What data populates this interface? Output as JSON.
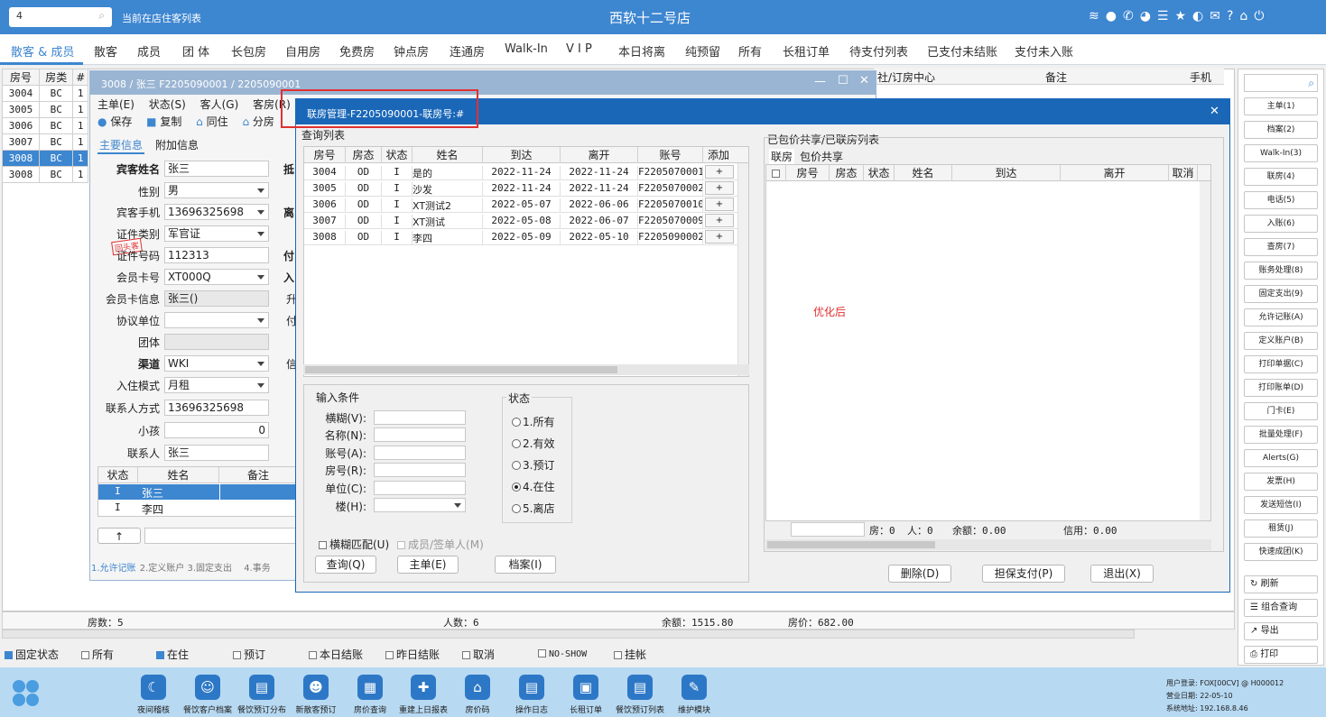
{
  "topbar": {
    "search_value": "4",
    "title_left": "当前在店住客列表",
    "title": "西软十二号店"
  },
  "nav": [
    "散客 & 成员",
    "散客",
    "成员",
    "团 体",
    "长包房",
    "自用房",
    "免费房",
    "钟点房",
    "连通房",
    "Walk-In",
    "V I P",
    "本日将离",
    "纯预留",
    "所有",
    "长租订单",
    "待支付列表",
    "已支付未结账",
    "支付未入账"
  ],
  "left_list": {
    "headers": [
      "房号",
      "房类",
      "#"
    ],
    "rows": [
      [
        "3004",
        "BC",
        "1"
      ],
      [
        "3005",
        "BC",
        "1"
      ],
      [
        "3006",
        "BC",
        "1"
      ],
      [
        "3007",
        "BC",
        "1"
      ],
      [
        "3008",
        "BC",
        "1"
      ],
      [
        "3008",
        "BC",
        "1"
      ]
    ],
    "selected": 4
  },
  "bg_headers": {
    "c1": "社/订房中心",
    "c2": "备注",
    "c3": "手机"
  },
  "guest_window": {
    "title": "3008 / 张三 F2205090001 / 2205090001",
    "menu": [
      "主单(E)",
      "状态(S)",
      "客人(G)",
      "客房(R)"
    ],
    "toolbar": [
      "保存",
      "复制",
      "同住",
      "分房"
    ],
    "tabs": [
      "主要信息",
      "附加信息"
    ],
    "fields": [
      {
        "label": "宾客姓名",
        "value": "张三",
        "bold": true
      },
      {
        "label": "性别",
        "value": "男",
        "dd": true
      },
      {
        "label": "宾客手机",
        "value": "13696325698",
        "dd": true
      },
      {
        "label": "证件类别",
        "value": "军官证",
        "dd": true
      },
      {
        "label": "证件号码",
        "value": "112313"
      },
      {
        "label": "会员卡号",
        "value": "XT000Q",
        "dd": true
      },
      {
        "label": "会员卡信息",
        "value": "张三()",
        "gray": true
      },
      {
        "label": "协议单位",
        "value": "",
        "dd": true
      },
      {
        "label": "团体",
        "value": "",
        "gray": true
      },
      {
        "label": "渠道",
        "value": "WKI",
        "dd": true,
        "bold": true
      },
      {
        "label": "入住模式",
        "value": "月租",
        "dd": true
      },
      {
        "label": "联系人方式",
        "value": "13696325698"
      },
      {
        "label": "小孩",
        "value": "0",
        "right": true
      },
      {
        "label": "联系人",
        "value": "张三"
      }
    ],
    "stamp": "回头客",
    "right_labels": [
      "抵",
      "离",
      "付",
      "入",
      "升",
      "付",
      "信"
    ],
    "companions": {
      "headers": [
        "状态",
        "姓名",
        "备注"
      ],
      "rows": [
        [
          "I",
          "张三"
        ],
        [
          "I",
          "李四"
        ]
      ]
    },
    "up_arrow": "↑",
    "bottom_tabs": [
      "1.允许记账",
      "2.定义账户",
      "3.固定支出",
      "4.事务"
    ]
  },
  "dialog": {
    "title": "联房管理-F2205090001-联房号:#",
    "query_title": "查询列表",
    "query_headers": [
      "房号",
      "房态",
      "状态",
      "姓名",
      "到达",
      "离开",
      "账号",
      "添加"
    ],
    "query_rows": [
      [
        "3004",
        "OD",
        "I",
        "是的",
        "2022-11-24",
        "2022-11-24",
        "F2205070001"
      ],
      [
        "3005",
        "OD",
        "I",
        "沙发",
        "2022-11-24",
        "2022-11-24",
        "F2205070002"
      ],
      [
        "3006",
        "OD",
        "I",
        "XT测试2",
        "2022-05-07",
        "2022-06-06",
        "F2205070010"
      ],
      [
        "3007",
        "OD",
        "I",
        "XT测试",
        "2022-05-08",
        "2022-06-07",
        "F2205070009"
      ],
      [
        "3008",
        "OD",
        "I",
        "李四",
        "2022-05-09",
        "2022-05-10",
        "F2205090002"
      ]
    ],
    "add_btn": "+",
    "input_title": "输入条件",
    "input_labels": [
      "横糊(V):",
      "名称(N):",
      "账号(A):",
      "房号(R):",
      "单位(C):",
      "楼(H):"
    ],
    "status_title": "状态",
    "status_options": [
      "1.所有",
      "2.有效",
      "3.预订",
      "4.在住",
      "5.离店"
    ],
    "status_selected": 3,
    "fuzzy_label": "横糊匹配(U)",
    "member_label": "成员/签单人(M)",
    "buttons": [
      "查询(Q)",
      "主单(E)",
      "档案(I)"
    ],
    "linked_title": "已包价共享/已联房列表",
    "linked_tabs": [
      "联房",
      "包价共享"
    ],
    "linked_headers": [
      "房号",
      "房态",
      "状态",
      "姓名",
      "到达",
      "离开",
      "取消"
    ],
    "annotation": "优化后",
    "summary": {
      "rooms": "房：0",
      "people": "人：0",
      "balance": "余额：0.00",
      "credit": "信用：0.00"
    },
    "bottom_buttons": [
      "删除(D)",
      "担保支付(P)",
      "退出(X)"
    ]
  },
  "right_panel": [
    "主单(1)",
    "档案(2)",
    "Walk-In(3)",
    "联房(4)",
    "电话(5)",
    "入账(6)",
    "查房(7)",
    "账务处理(8)",
    "固定支出(9)",
    "允许记账(A)",
    "定义账户(B)",
    "打印单据(C)",
    "打印账单(D)",
    "门卡(E)",
    "批量处理(F)",
    "Alerts(G)",
    "发票(H)",
    "发送短信(I)",
    "租赁(J)",
    "快速成团(K)"
  ],
  "right_panel2": [
    "刷新",
    "组合查询",
    "导出",
    "打印"
  ],
  "status_line": {
    "rooms": "房数：5",
    "people": "人数：6",
    "balance": "余额：1515.80",
    "price": "房价：682.00"
  },
  "filters": [
    {
      "label": "固定状态",
      "on": true
    },
    {
      "label": "所有",
      "on": false
    },
    {
      "label": "在住",
      "on": true
    },
    {
      "label": "预订",
      "on": false
    },
    {
      "label": "本日结账",
      "on": false
    },
    {
      "label": "昨日结账",
      "on": false
    },
    {
      "label": "取消",
      "on": false
    },
    {
      "label": "NO-SHOW",
      "on": false
    },
    {
      "label": "挂帐",
      "on": false
    }
  ],
  "taskbar": [
    "夜间稽核",
    "餐饮客户档案",
    "餐饮预订分布",
    "新散客预订",
    "房价查询",
    "重建上日报表",
    "房价码",
    "操作日志",
    "长租订单",
    "餐饮预订列表",
    "维护模块"
  ],
  "sysinfo": [
    "用户登录: FOX[00CV] @ H000012",
    "营业日期: 22-05-10",
    "系统地址: 192.168.8.46"
  ],
  "colors": {
    "accent": "#3d86d0",
    "dialog_title": "#1a67b8",
    "annotation": "#e03030"
  }
}
